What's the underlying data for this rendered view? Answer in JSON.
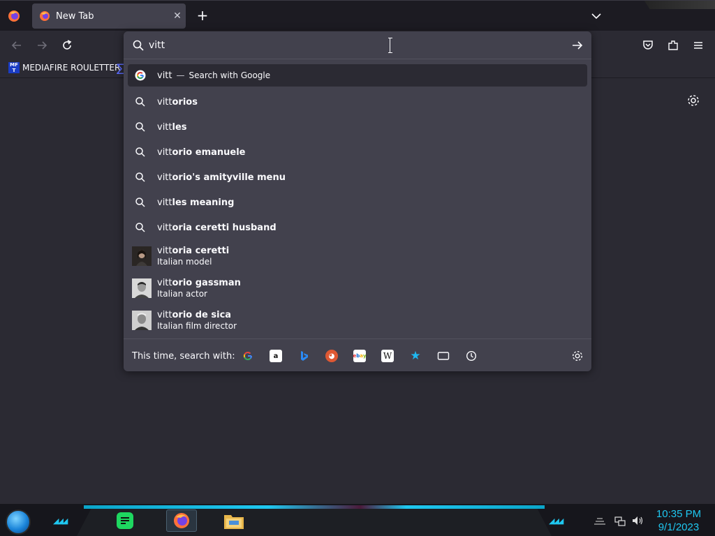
{
  "browser": {
    "tab": {
      "title": "New Tab",
      "close_glyph": "✕"
    },
    "new_tab_glyph": "+",
    "bookmarks": [
      {
        "icon_text": "MF T",
        "label": "MEDIAFIRE ROULETTER"
      }
    ]
  },
  "urlbar": {
    "value": "vitt",
    "selected": {
      "query": "vitt",
      "separator": "—",
      "action": "Search with Google"
    },
    "suggestions": [
      {
        "typed": "vitt",
        "rest": "orios"
      },
      {
        "typed": "vitt",
        "rest": "les"
      },
      {
        "typed": "vitt",
        "rest": "orio emanuele"
      },
      {
        "typed": "vitt",
        "rest": "orio's amityville menu"
      },
      {
        "typed": "vitt",
        "rest": "les meaning"
      },
      {
        "typed": "vitt",
        "rest": "oria ceretti husband"
      }
    ],
    "rich_suggestions": [
      {
        "typed": "vitt",
        "rest": "oria ceretti",
        "description": "Italian model"
      },
      {
        "typed": "vitt",
        "rest": "orio gassman",
        "description": "Italian actor"
      },
      {
        "typed": "vitt",
        "rest": "orio de sica",
        "description": "Italian film director"
      }
    ],
    "oneoff_label": "This time, search with:",
    "engines": [
      "google-icon",
      "amazon-icon",
      "bing-icon",
      "duckduckgo-icon",
      "ebay-icon",
      "wikipedia-icon",
      "bookmarks-icon",
      "tabs-icon",
      "history-icon"
    ]
  },
  "taskbar": {
    "time": "10:35 PM",
    "date": "9/1/2023"
  },
  "colors": {
    "toolbar": "#2b2a33",
    "tabstrip": "#1c1b22",
    "popup": "#42414d",
    "accent": "#1fc7f0"
  }
}
